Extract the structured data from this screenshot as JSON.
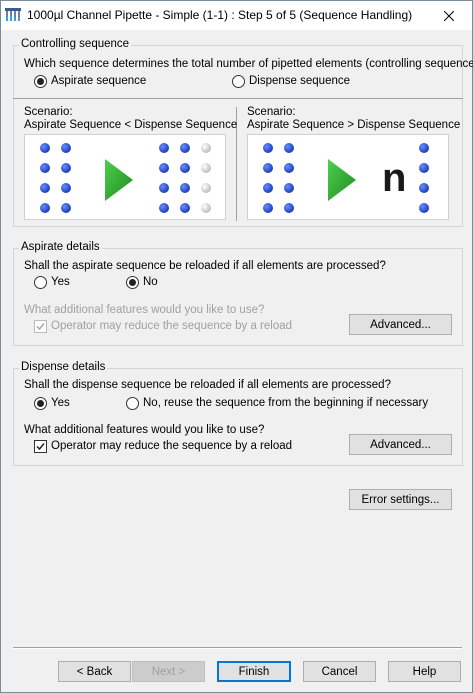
{
  "window": {
    "title": "1000µl Channel Pipette - Simple (1-1) : Step 5 of 5 (Sequence Handling)"
  },
  "controlling": {
    "legend": "Controlling sequence",
    "question": "Which sequence determines the total number of pipetted elements (controlling sequence)?",
    "option_aspirate": "Aspirate sequence",
    "option_dispense": "Dispense sequence",
    "selected": "aspirate",
    "scenario1": {
      "line1": "Scenario:",
      "line2": "Aspirate Sequence < Dispense Sequence"
    },
    "scenario2": {
      "line1": "Scenario:",
      "line2": "Aspirate Sequence > Dispense Sequence",
      "symbol": "n"
    }
  },
  "aspirate": {
    "legend": "Aspirate details",
    "question": "Shall the aspirate sequence be reloaded if all elements are processed?",
    "yes": "Yes",
    "no": "No",
    "selected": "no",
    "features_question": "What additional features would you like to use?",
    "operator_reduce": "Operator may reduce the sequence by a reload",
    "operator_checked": true,
    "advanced": "Advanced..."
  },
  "dispense": {
    "legend": "Dispense details",
    "question": "Shall the dispense sequence be reloaded if all elements are processed?",
    "yes": "Yes",
    "no": "No, reuse the sequence from the beginning if necessary",
    "selected": "yes",
    "features_question": "What additional features would you like to use?",
    "operator_reduce": "Operator may reduce the sequence by a reload",
    "operator_checked": true,
    "advanced": "Advanced..."
  },
  "error_settings": "Error settings...",
  "footer": {
    "back": "< Back",
    "next": "Next >",
    "finish": "Finish",
    "cancel": "Cancel",
    "help": "Help"
  },
  "colors": {
    "dot": "#1c3fb8",
    "dot_gray": "#c8c8c8",
    "arrow": "#2aa32a",
    "focus": "#0078d7"
  }
}
